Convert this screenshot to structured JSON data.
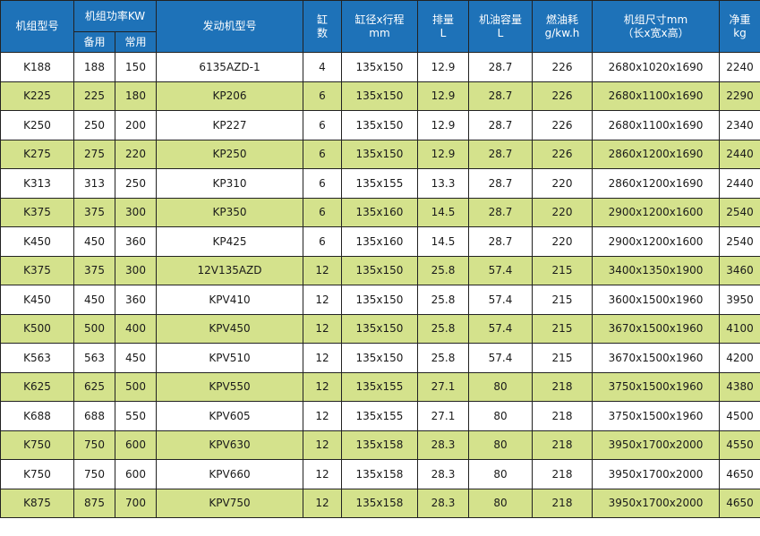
{
  "header": {
    "model": "机组型号",
    "power_group": "机组功率KW",
    "standby": "备用",
    "prime": "常用",
    "engine": "发动机型号",
    "cylinders": [
      "缸",
      "数"
    ],
    "bore_stroke": [
      "缸径x行程",
      "mm"
    ],
    "displacement": [
      "排量",
      "L"
    ],
    "oil_capacity": [
      "机油容量",
      "L"
    ],
    "fuel_consumption": [
      "燃油耗",
      "g/kw.h"
    ],
    "dimensions": [
      "机组尺寸mm",
      "（长x宽x高）"
    ],
    "weight": [
      "净重",
      "kg"
    ]
  },
  "rows": [
    [
      "K188",
      "188",
      "150",
      "6135AZD-1",
      "4",
      "135x150",
      "12.9",
      "28.7",
      "226",
      "2680x1020x1690",
      "2240"
    ],
    [
      "K225",
      "225",
      "180",
      "KP206",
      "6",
      "135x150",
      "12.9",
      "28.7",
      "226",
      "2680x1100x1690",
      "2290"
    ],
    [
      "K250",
      "250",
      "200",
      "KP227",
      "6",
      "135x150",
      "12.9",
      "28.7",
      "226",
      "2680x1100x1690",
      "2340"
    ],
    [
      "K275",
      "275",
      "220",
      "KP250",
      "6",
      "135x150",
      "12.9",
      "28.7",
      "226",
      "2860x1200x1690",
      "2440"
    ],
    [
      "K313",
      "313",
      "250",
      "KP310",
      "6",
      "135x155",
      "13.3",
      "28.7",
      "220",
      "2860x1200x1690",
      "2440"
    ],
    [
      "K375",
      "375",
      "300",
      "KP350",
      "6",
      "135x160",
      "14.5",
      "28.7",
      "220",
      "2900x1200x1600",
      "2540"
    ],
    [
      "K450",
      "450",
      "360",
      "KP425",
      "6",
      "135x160",
      "14.5",
      "28.7",
      "220",
      "2900x1200x1600",
      "2540"
    ],
    [
      "K375",
      "375",
      "300",
      "12V135AZD",
      "12",
      "135x150",
      "25.8",
      "57.4",
      "215",
      "3400x1350x1900",
      "3460"
    ],
    [
      "K450",
      "450",
      "360",
      "KPV410",
      "12",
      "135x150",
      "25.8",
      "57.4",
      "215",
      "3600x1500x1960",
      "3950"
    ],
    [
      "K500",
      "500",
      "400",
      "KPV450",
      "12",
      "135x150",
      "25.8",
      "57.4",
      "215",
      "3670x1500x1960",
      "4100"
    ],
    [
      "K563",
      "563",
      "450",
      "KPV510",
      "12",
      "135x150",
      "25.8",
      "57.4",
      "215",
      "3670x1500x1960",
      "4200"
    ],
    [
      "K625",
      "625",
      "500",
      "KPV550",
      "12",
      "135x155",
      "27.1",
      "80",
      "218",
      "3750x1500x1960",
      "4380"
    ],
    [
      "K688",
      "688",
      "550",
      "KPV605",
      "12",
      "135x155",
      "27.1",
      "80",
      "218",
      "3750x1500x1960",
      "4500"
    ],
    [
      "K750",
      "750",
      "600",
      "KPV630",
      "12",
      "135x158",
      "28.3",
      "80",
      "218",
      "3950x1700x2000",
      "4550"
    ],
    [
      "K750",
      "750",
      "600",
      "KPV660",
      "12",
      "135x158",
      "28.3",
      "80",
      "218",
      "3950x1700x2000",
      "4650"
    ],
    [
      "K875",
      "875",
      "700",
      "KPV750",
      "12",
      "135x158",
      "28.3",
      "80",
      "218",
      "3950x1700x2000",
      "4650"
    ]
  ],
  "colors": {
    "header_bg": "#1e72b8",
    "header_text": "#ffffff",
    "row_alt_bg": "#d4e28c",
    "row_bg": "#ffffff",
    "border": "#222222"
  }
}
